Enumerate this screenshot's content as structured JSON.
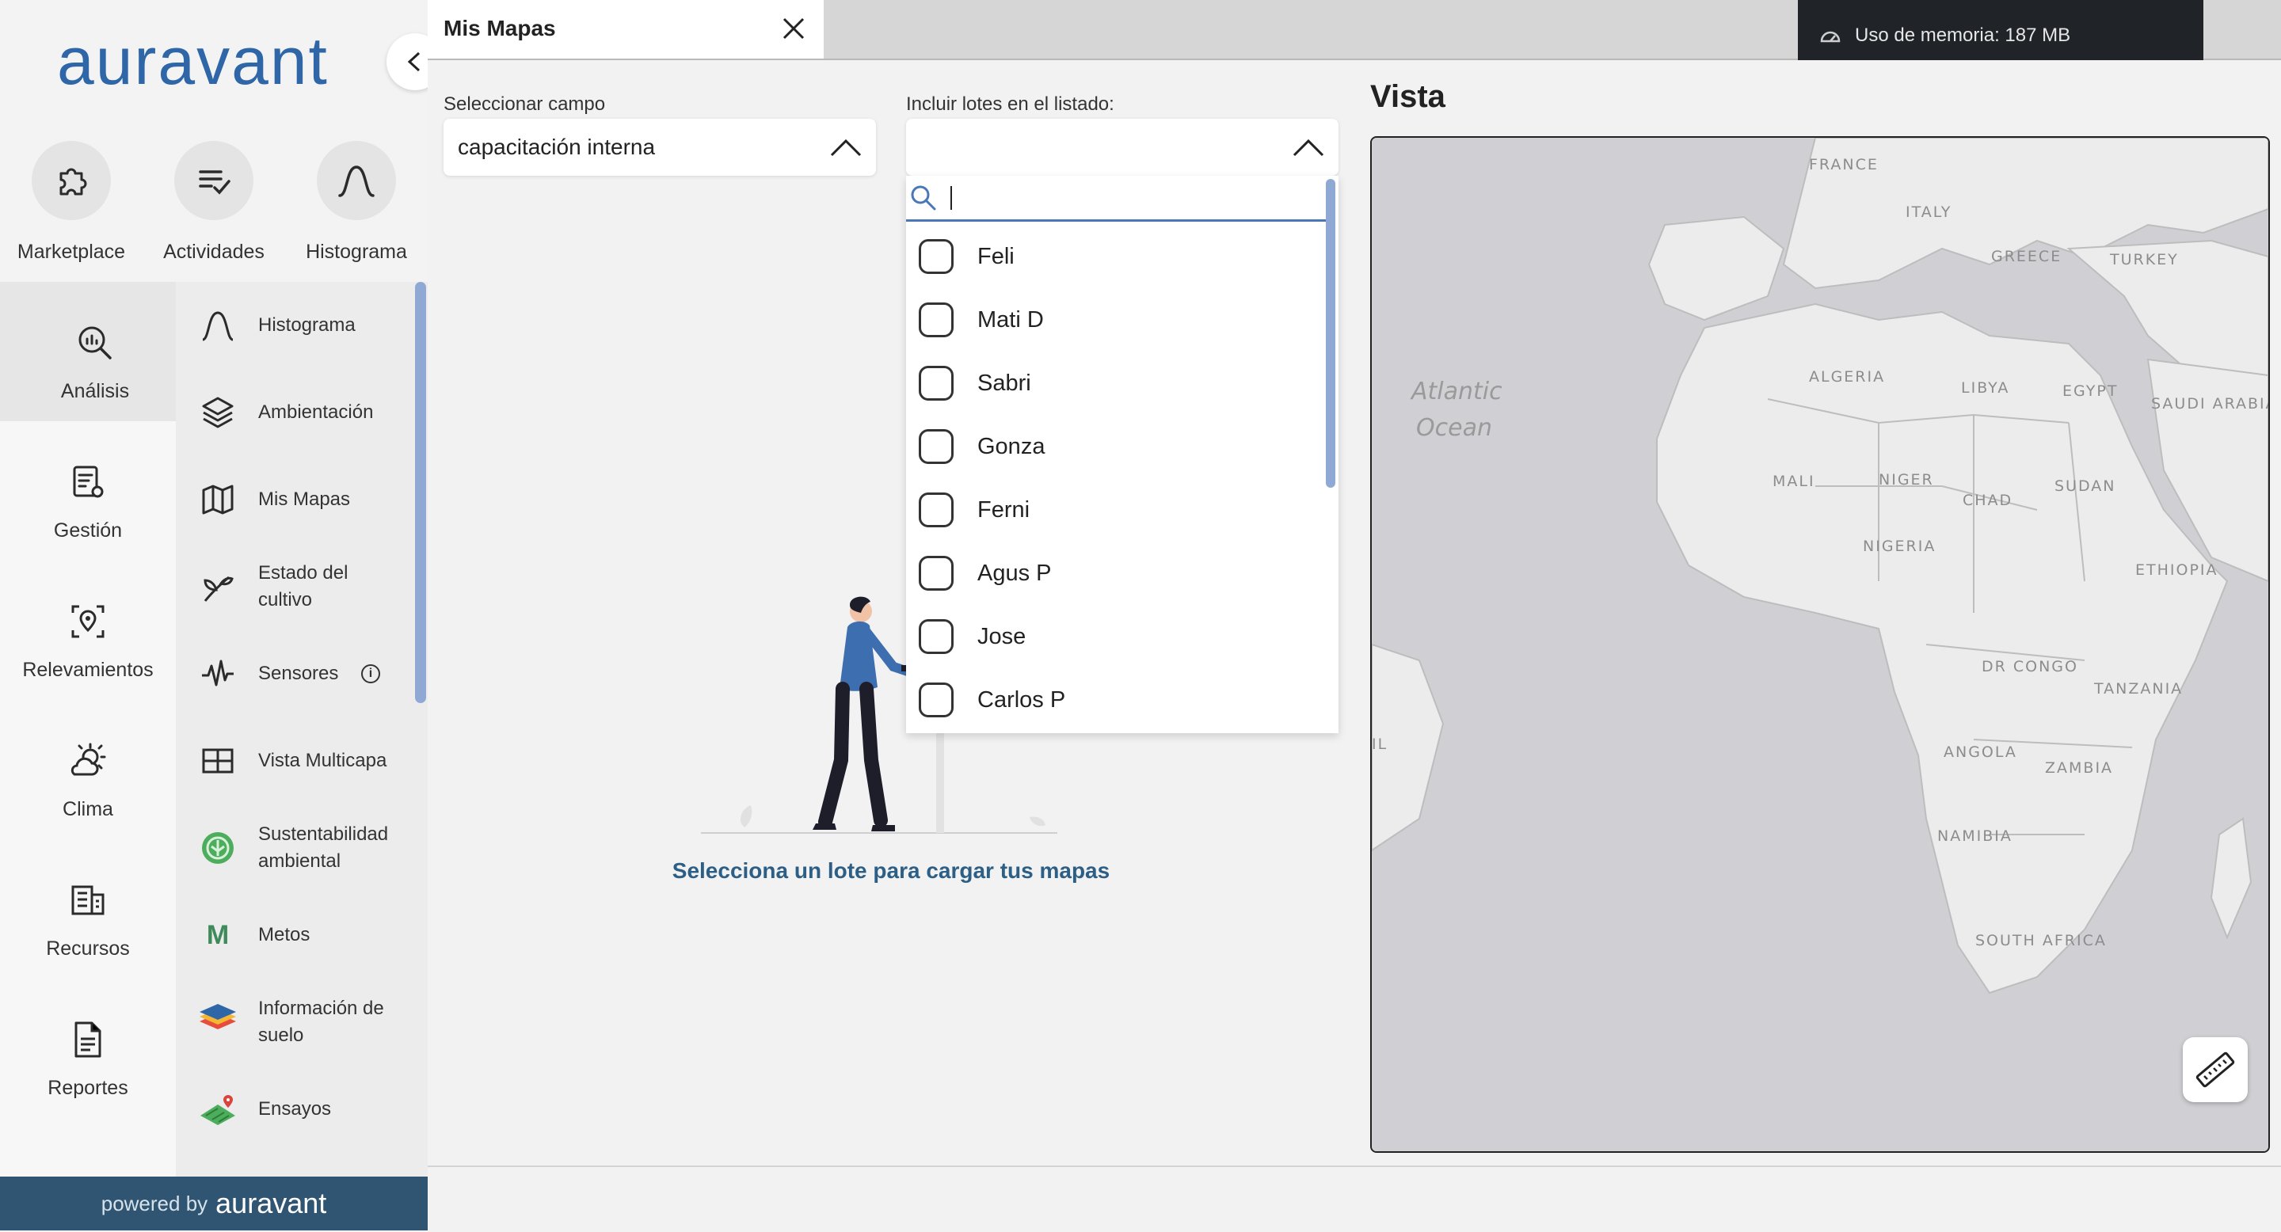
{
  "brand": {
    "logo_text": "auravant",
    "powered_prefix": "powered by",
    "powered_brand": "auravant",
    "color_primary": "#2f66a8",
    "color_footer": "#2f5572"
  },
  "quick_actions": [
    {
      "label": "Marketplace",
      "icon": "puzzle-icon"
    },
    {
      "label": "Actividades",
      "icon": "checklist-icon"
    },
    {
      "label": "Histograma",
      "icon": "histogram-curve-icon"
    }
  ],
  "categories": [
    {
      "label": "Análisis",
      "icon": "analysis-search-icon",
      "active": true
    },
    {
      "label": "Gestión",
      "icon": "management-settings-icon"
    },
    {
      "label": "Relevamientos",
      "icon": "survey-location-icon"
    },
    {
      "label": "Clima",
      "icon": "weather-icon"
    },
    {
      "label": "Recursos",
      "icon": "resources-icon"
    },
    {
      "label": "Reportes",
      "icon": "report-document-icon"
    }
  ],
  "submenu": [
    {
      "label": "Histograma",
      "icon": "histogram-curve-icon"
    },
    {
      "label": "Ambientación",
      "icon": "layers-icon"
    },
    {
      "label": "Mis Mapas",
      "icon": "map-icon"
    },
    {
      "label": "Estado del cultivo",
      "icon": "crop-leaf-icon"
    },
    {
      "label": "Sensores",
      "icon": "pulse-icon",
      "info": "i"
    },
    {
      "label": "Vista Multicapa",
      "icon": "grid-icon"
    },
    {
      "label": "Sustentabilidad ambiental",
      "icon": "sustainability-icon"
    },
    {
      "label": "Metos",
      "icon": "metos-logo-icon",
      "letter": "M"
    },
    {
      "label": "Información de suelo",
      "icon": "soil-layers-icon"
    },
    {
      "label": "Ensayos",
      "icon": "trial-field-icon"
    }
  ],
  "tab": {
    "title": "Mis Mapas",
    "close_icon": "close-icon"
  },
  "memory": {
    "text": "Uso de memoria: 187 MB",
    "icon": "speedometer-icon"
  },
  "field_select": {
    "label": "Seleccionar campo",
    "value": "capacitación interna"
  },
  "lots_select": {
    "label": "Incluir lotes en el listado:",
    "search_value": "",
    "options": [
      "Feli",
      "Mati D",
      "Sabri",
      "Gonza",
      "Ferni",
      "Agus P",
      "Jose",
      "Carlos P"
    ]
  },
  "empty_state": {
    "message": "Selecciona un lote para cargar tus mapas"
  },
  "vista": {
    "title": "Vista",
    "map_labels": {
      "ocean_line1": "Atlantic",
      "ocean_line2": "Ocean",
      "countries": [
        "FRANCE",
        "ITALY",
        "GREECE",
        "TURKEY",
        "ALGERIA",
        "LIBYA",
        "EGYPT",
        "SAUDI ARABIA",
        "MALI",
        "NIGER",
        "CHAD",
        "SUDAN",
        "NIGERIA",
        "ETHIOPIA",
        "DR CONGO",
        "TANZANIA",
        "ANGOLA",
        "ZAMBIA",
        "NAMIBIA",
        "SOUTH AFRICA",
        "IL"
      ]
    },
    "ruler_icon": "ruler-icon"
  }
}
